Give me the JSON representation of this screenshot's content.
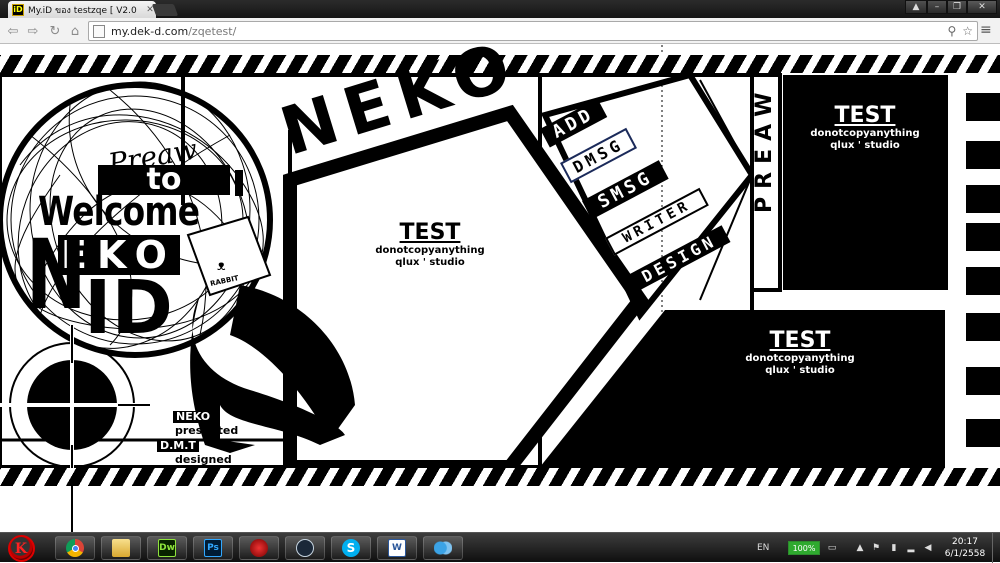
{
  "browser": {
    "tab_title": "My.iD ของ testzqe [ V2.0 ]",
    "tab_favicon": "iD",
    "url_host": "my.dek-d.com",
    "url_path": "/zqetest/",
    "window_buttons": [
      "user",
      "minimize",
      "maximize",
      "close"
    ]
  },
  "page": {
    "neko_big": "NEKO",
    "hero_lines": [
      "Preaw",
      "to",
      "Welcome",
      "EKO",
      "N",
      "ID"
    ],
    "mascot_text": "RABBIT",
    "tests": [
      {
        "heading": "TEST",
        "line1": "donotcopyanything",
        "line2": "qlux ' studio"
      },
      {
        "heading": "TEST",
        "line1": "donotcopyanything",
        "line2": "qlux ' studio"
      },
      {
        "heading": "TEST",
        "line1": "donotcopyanything",
        "line2": "qlux ' studio"
      }
    ],
    "nav": {
      "add": "ADD",
      "dmsg": "DMSG",
      "smsg": "SMSG",
      "writer": "WRITER",
      "design": "DESIGN"
    },
    "preaw_vertical": "PREAW",
    "credits": [
      "NEKO",
      "presented",
      "D.M.T",
      "designed"
    ]
  },
  "taskbar": {
    "apps": [
      "chrome",
      "explorer",
      "dreamweaver",
      "photoshop",
      "game",
      "steam",
      "skype",
      "word",
      "messenger"
    ],
    "app_labels": {
      "dreamweaver": "Dw",
      "photoshop": "Ps",
      "word": "W"
    },
    "language": "EN",
    "battery": "100%",
    "time": "20:17",
    "date": "6/1/2558"
  }
}
